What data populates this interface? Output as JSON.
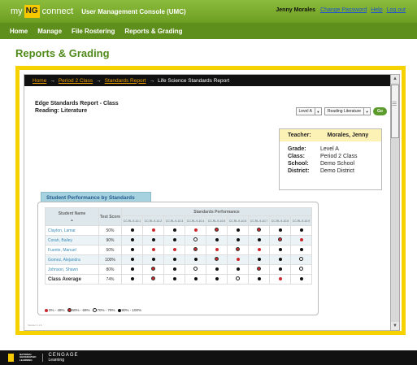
{
  "header": {
    "logo_my": "my",
    "logo_ng": "NG",
    "logo_connect": "connect",
    "app_title": "User Management Console (UMC)",
    "user_name": "Jenny Morales",
    "change_password": "Change Password",
    "help": "Help",
    "logout": "Log out"
  },
  "nav": [
    "Home",
    "Manage",
    "File Rostering",
    "Reports & Grading"
  ],
  "page_title": "Reports & Grading",
  "breadcrumb": {
    "home": "Home",
    "class": "Period 2 Class",
    "standards": "Standards Report",
    "current": "Life Science Standards Report"
  },
  "report": {
    "title_line1": "Edge Standards Report - Class",
    "title_line2": "Reading: Literature",
    "level_select": "Level A",
    "subject_select": "Reading Literature",
    "go_label": "Go"
  },
  "info": {
    "teacher_label": "Teacher:",
    "teacher": "Morales, Jenny",
    "grade_label": "Grade:",
    "grade": "Level A",
    "class_label": "Class:",
    "class": "Period 2 Class",
    "school_label": "School:",
    "school": "Demo School",
    "district_label": "District:",
    "district": "Demo District"
  },
  "performance": {
    "tab_label": "Student Performance by Standards",
    "col_student": "Student Name",
    "col_score": "Test Score",
    "col_standards": "Standards Performance",
    "standards": [
      "CC.RL.9-10.1",
      "CC.RL.9-10.2",
      "CC.RL.9-10.3",
      "CC.RL.9-10.4",
      "CC.RL.9-10.5",
      "CC.RL.9-10.6",
      "CC.RL.9-10.7",
      "CC.RL.9-10.8",
      "CC.RL.9-10.9"
    ],
    "rows": [
      {
        "name": "Clayton, Lamar",
        "score": "50%",
        "marks": [
          4,
          1,
          4,
          1,
          2,
          4,
          2,
          4,
          4
        ]
      },
      {
        "name": "Corah, Bailey",
        "score": "90%",
        "marks": [
          4,
          4,
          4,
          3,
          4,
          4,
          4,
          2,
          1
        ]
      },
      {
        "name": "Fuente, Manuel",
        "score": "50%",
        "marks": [
          4,
          1,
          1,
          2,
          1,
          2,
          1,
          4,
          4
        ]
      },
      {
        "name": "Gomez, Alejandra",
        "score": "100%",
        "marks": [
          4,
          4,
          4,
          4,
          2,
          1,
          4,
          4,
          3
        ]
      },
      {
        "name": "Johnson, Shawn",
        "score": "80%",
        "marks": [
          4,
          2,
          4,
          3,
          4,
          4,
          2,
          4,
          3
        ]
      },
      {
        "name": "Class Average",
        "score": "74%",
        "marks": [
          4,
          2,
          4,
          4,
          4,
          3,
          4,
          1,
          4
        ]
      }
    ],
    "legend": [
      "0% - 49%",
      "50% - 69%",
      "70% - 79%",
      "80% - 100%"
    ]
  },
  "version": "Version 1.1.6",
  "footer": {
    "ng_line1": "NATIONAL",
    "ng_line2": "GEOGRAPHIC",
    "ng_line3": "LEARNING",
    "cengage": "CENGAGE",
    "learning": "Learning"
  },
  "colors": {
    "green": "#6c9e22",
    "yellow": "#f5d200",
    "red_dot": "#c8292d"
  }
}
